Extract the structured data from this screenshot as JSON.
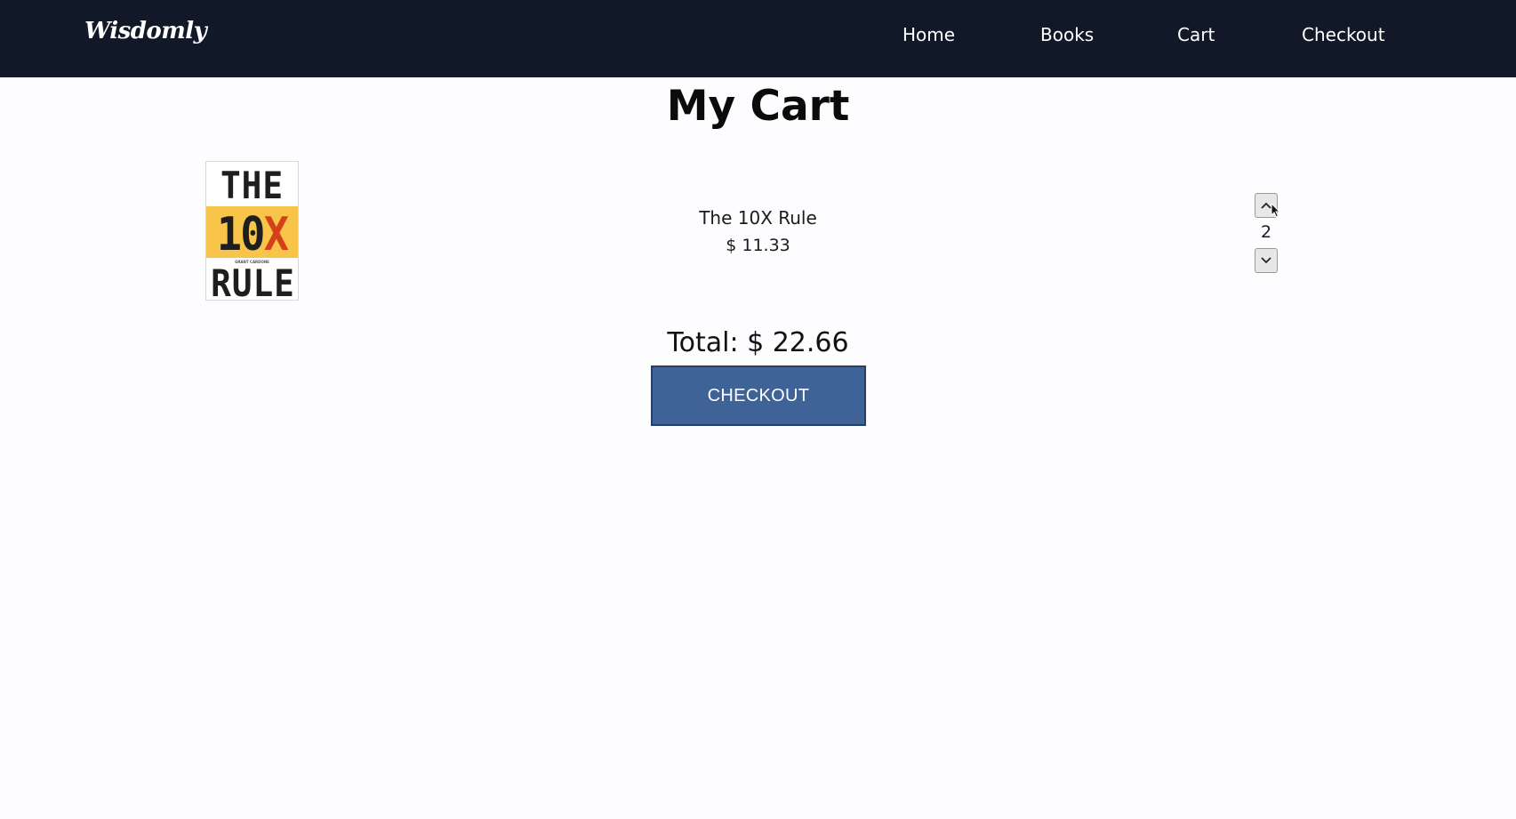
{
  "brand": {
    "logo": "Wisdomly"
  },
  "nav": {
    "home": "Home",
    "books": "Books",
    "cart": "Cart",
    "checkout": "Checkout"
  },
  "page": {
    "title": "My Cart"
  },
  "cart": {
    "items": [
      {
        "title": "The 10X Rule",
        "price": "$ 11.33",
        "quantity": "2",
        "cover": {
          "line1": "THE",
          "line2_num": "10",
          "line2_x": "X",
          "line3": "RULE",
          "author": "GRANT CARDONE",
          "band_color": "#f8c44a",
          "x_color": "#d3401a"
        }
      }
    ],
    "total": "Total: $ 22.66",
    "checkout_label": "CHECKOUT"
  },
  "colors": {
    "navbar": "#111827",
    "checkout_button": "#3f6297",
    "background": "#fdfcfe"
  },
  "icons": {
    "qty_up": "chevron-up-icon",
    "qty_down": "chevron-down-icon",
    "cursor": "mouse-pointer-icon"
  }
}
